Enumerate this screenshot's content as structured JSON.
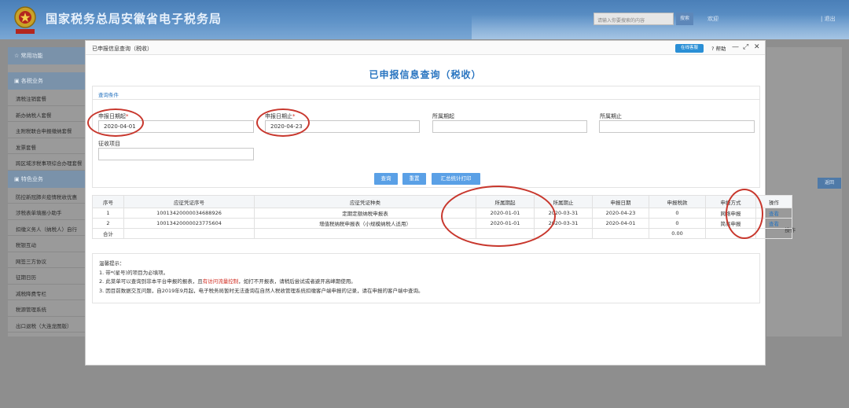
{
  "colors": {
    "accent": "#2874c0",
    "button": "#5aa0e6",
    "warning": "#d02b20",
    "highlight_ring": "#c8372d"
  },
  "header": {
    "site_title": "国家税务总局安徽省电子税务局",
    "search_placeholder": "请输入你要搜索的内容",
    "search_button": "搜索",
    "welcome": "欢迎",
    "exit": "| 退出"
  },
  "sidebar": {
    "section_common": "常用功能",
    "section_tax": "各税业务",
    "items_tax": [
      "清税注销套餐",
      "新办纳税人套餐",
      "主附税联合申报缴纳套餐",
      "发票套餐",
      "跨区域涉税事项综合办理套餐"
    ],
    "section_special": "特色业务",
    "items_special": [
      "防控新冠肺炎疫情税收优惠",
      "涉税表单填报小助手",
      "扣缴义务人（纳税人）自行",
      "税银互动",
      "网签三方协议",
      "征期日历",
      "减税降费专栏",
      "税源管理系统",
      "出口退税（大连龙图版）"
    ]
  },
  "background_main": {
    "back_button": "返回",
    "op_label": "操作"
  },
  "modal": {
    "window_title": "已申报信息查询（税收）",
    "online_service": "在线客服",
    "help": "帮助",
    "heading": "已申报信息查询（税收）",
    "conditions_title": "查询条件",
    "fields": {
      "date_from": {
        "label": "申报日期起",
        "required_mark": "*",
        "value": "2020-04-01"
      },
      "date_to": {
        "label": "申报日期止",
        "required_mark": "*",
        "value": "2020-04-23"
      },
      "period_from": {
        "label": "所属期起",
        "value": ""
      },
      "period_to": {
        "label": "所属期止",
        "value": ""
      },
      "levy_item": {
        "label": "征收项目",
        "value": ""
      }
    },
    "buttons": {
      "query": "查询",
      "reset": "重置",
      "summary_print": "汇总统计打印"
    },
    "table": {
      "headers": [
        "序号",
        "应征凭证序号",
        "应征凭证种类",
        "所属期起",
        "所属期止",
        "申报日期",
        "申报税款",
        "申报方式",
        "操作"
      ],
      "rows": [
        [
          "1",
          "10013420000034688926",
          "定期定额纳税申报表",
          "2020-01-01",
          "2020-03-31",
          "2020-04-23",
          "0",
          "网络申报",
          "查看"
        ],
        [
          "2",
          "10013420000023775604",
          "增值税纳税申报表（小规模纳税人适用）",
          "2020-01-01",
          "2020-03-31",
          "2020-04-01",
          "0",
          "简易申报",
          "查看"
        ]
      ],
      "total_label": "合计",
      "total_tax": "0.00"
    },
    "notes": {
      "title": "温馨提示：",
      "line1": "1. 带*(星号)的项目为必填项。",
      "line2_a": "2. 此菜单可以查询到非本平台申报的报表，且",
      "line2_red": "有访问流量控制",
      "line2_b": "，如打不开报表，请稍后尝试或者避开高峰期使用。",
      "line3": "3. 因目前数据交互问题，自2019年9月起，电子税务局暂时无法查询在自然人税收管理系统扣缴客户端申报的记录，请在申报的客户端中查询。"
    }
  }
}
